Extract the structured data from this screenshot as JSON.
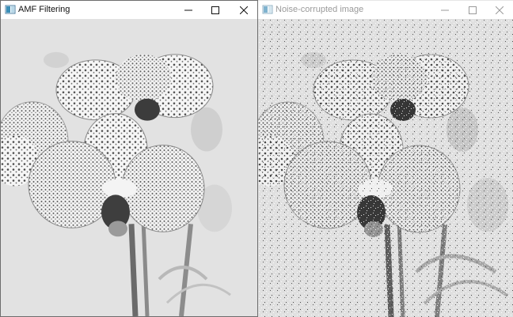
{
  "windows": {
    "left": {
      "title": "AMF Filtering",
      "icon": "app-window-icon",
      "controls": [
        "minimize-icon",
        "maximize-icon",
        "close-icon"
      ],
      "content": "orchid-photo-filtered"
    },
    "right": {
      "title": "Noise-corrupted image",
      "icon": "app-window-icon",
      "controls": [
        "minimize-icon",
        "maximize-icon",
        "close-icon"
      ],
      "content": "orchid-photo-noisy"
    }
  },
  "colors": {
    "title_active": "#111111",
    "title_inactive": "#9a9a9a",
    "active_border": "#6d6d6d",
    "image_bg": "#e4e4e4"
  }
}
